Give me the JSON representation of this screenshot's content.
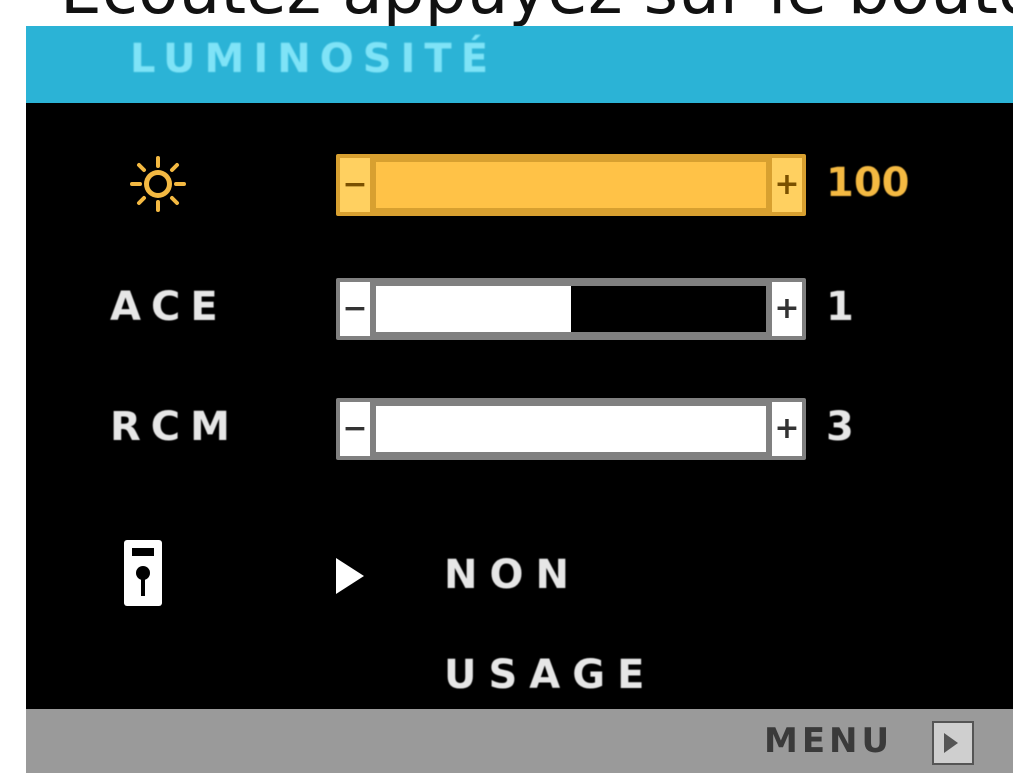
{
  "caption_fragment": "Ecoutez appuyez sur le bouton",
  "title": "LUMINOSITÉ",
  "rows": {
    "brightness": {
      "icon": "sun-icon",
      "minus": "−",
      "plus": "+",
      "value_label": "100",
      "level": 1.0
    },
    "ace": {
      "label": "ACE",
      "minus": "−",
      "plus": "+",
      "value_label": "1",
      "level": 0.5
    },
    "rcm": {
      "label": "RCM",
      "minus": "−",
      "plus": "+",
      "value_label": "3",
      "level": 1.0
    }
  },
  "remote": {
    "icon": "remote-control-icon",
    "selector_icon": "play-arrow-icon",
    "options": [
      "NON",
      "USAGE"
    ],
    "selected": "NON"
  },
  "footer": {
    "menu_label": "MENU",
    "menu_icon": "exit-arrow-icon"
  },
  "colors": {
    "title_bar": "#2bb3d6",
    "title_text": "#7fe3f7",
    "highlight": "#ffc247",
    "footer": "#9a9a9a"
  }
}
